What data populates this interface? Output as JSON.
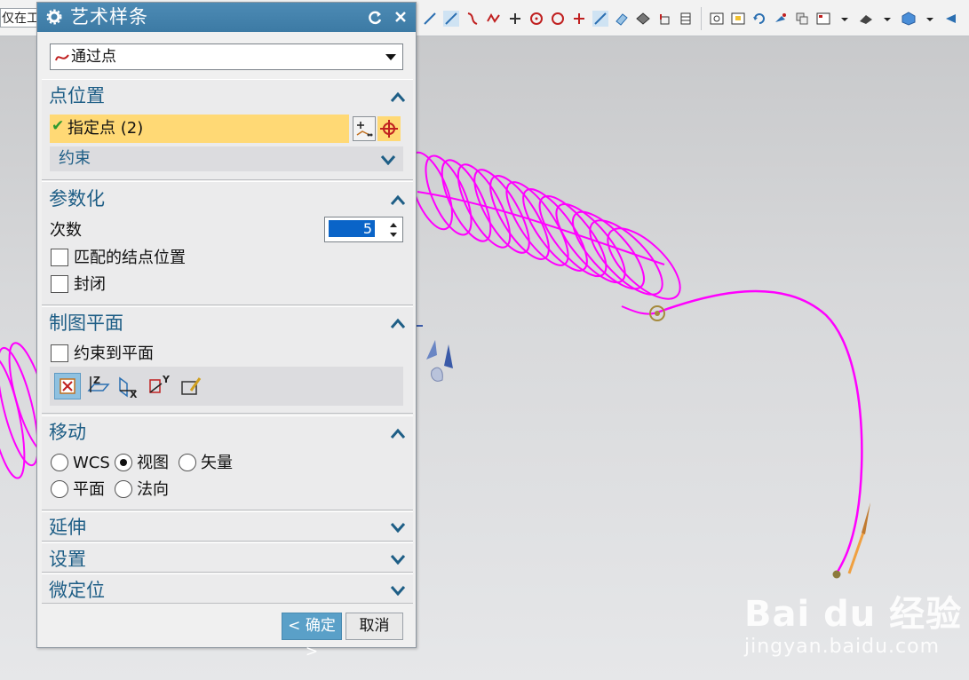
{
  "toolbar": {
    "left_field_text": "仅在工作",
    "icons": [
      "line-icon",
      "line-icon",
      "arc-icon",
      "spline-icon",
      "point-icon",
      "circle-icon",
      "circle-icon",
      "plus-icon",
      "line-icon",
      "sketch-icon",
      "surface-icon",
      "datum-icon",
      "table-icon",
      "view-icon",
      "view-icon",
      "rotate-icon",
      "view-icon",
      "view-icon",
      "layout-icon",
      "shading-icon",
      "cube-icon",
      "view-icon"
    ]
  },
  "dialog": {
    "title": "艺术样条",
    "type_combo": {
      "value": "通过点"
    },
    "sections": {
      "point_position": {
        "title": "点位置",
        "specify_point": "指定点 (2)",
        "constraint": "约束"
      },
      "parameterization": {
        "title": "参数化",
        "degree_label": "次数",
        "degree_value": "5",
        "match_knots_label": "匹配的结点位置",
        "closed_label": "封闭"
      },
      "drawing_plane": {
        "title": "制图平面",
        "constrain_label": "约束到平面",
        "plane_axis_labels": [
          "Z",
          "X",
          "Y"
        ]
      },
      "move": {
        "title": "移动",
        "options": [
          "WCS",
          "视图",
          "矢量",
          "平面",
          "法向"
        ],
        "selected": "视图"
      },
      "extend": {
        "title": "延伸"
      },
      "settings": {
        "title": "设置"
      },
      "fine_position": {
        "title": "微定位"
      }
    },
    "ok_label": "< 确定 >",
    "cancel_label": "取消"
  },
  "watermark": {
    "logo_text": "Bai du 经验",
    "url_text": "jingyan.baidu.com"
  },
  "colors": {
    "title_bar": "#3c7aa4",
    "section_title": "#1e5e86",
    "highlight": "#ffd975",
    "curve": "#ff00ff",
    "annotation_arrow": "#e02020",
    "value_selected": "#0a64c8"
  }
}
